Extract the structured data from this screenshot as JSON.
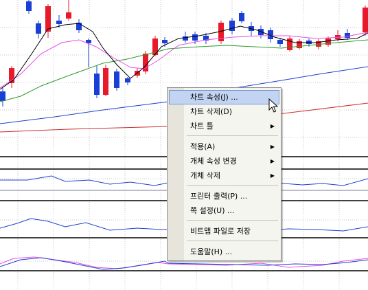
{
  "context_menu": {
    "items": [
      {
        "label": "차트 속성(J) ...",
        "submenu": false,
        "highlighted": true
      },
      {
        "label": "차트 삭제(D)",
        "submenu": false
      },
      {
        "label": "차트 틀",
        "submenu": true
      },
      {
        "label": "적용(A)",
        "submenu": true
      },
      {
        "label": "개체 속성 변경",
        "submenu": true
      },
      {
        "label": "개체 삭제",
        "submenu": true
      },
      {
        "label": "프린터 출력(P) ...",
        "submenu": false
      },
      {
        "label": "쪽 설정(U) ...",
        "submenu": false
      },
      {
        "label": "비트맵 파일로 저장",
        "submenu": false
      },
      {
        "label": "도움말(H) ...",
        "submenu": false
      }
    ],
    "submenu_arrow": "▶"
  },
  "colors": {
    "up_candle": "#e8192a",
    "down_candle": "#1a3fd6",
    "ma_black": "#000000",
    "ma_magenta": "#e84ee8",
    "ma_green": "#2a9a2a",
    "trend_blue": "#1f3fcc",
    "trend_red": "#cc2d2d",
    "grid": "#c8c8c8",
    "menu_highlight": "#c2d4f2"
  },
  "icons": {
    "cursor": "mouse-pointer-icon",
    "submenu": "submenu-arrow-icon"
  }
}
